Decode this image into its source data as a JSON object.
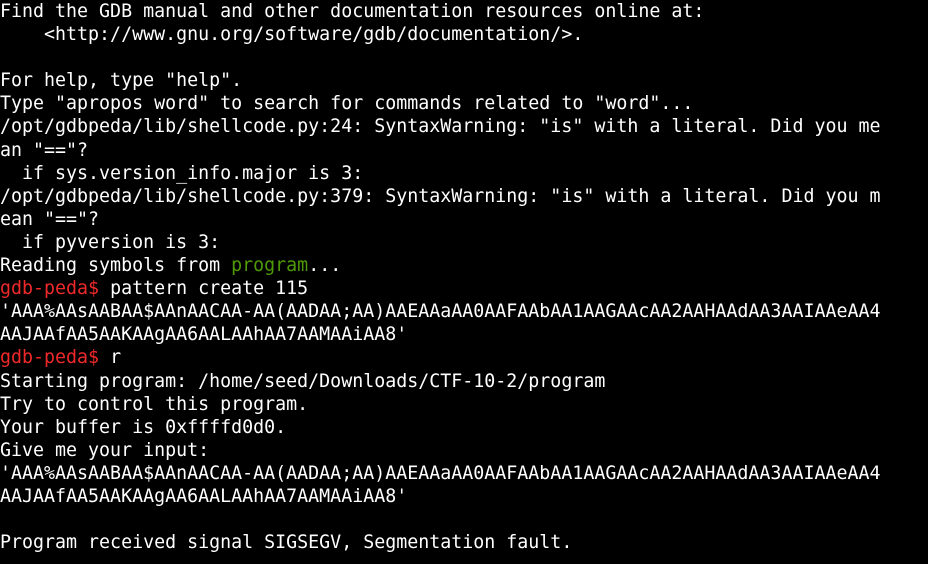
{
  "colors": {
    "background": "#000000",
    "text": "#ffffff",
    "prompt": "#ef2929",
    "highlight": "#4e9a06"
  },
  "terminal": {
    "l01": "Find the GDB manual and other documentation resources online at:",
    "l02": "    <http://www.gnu.org/software/gdb/documentation/>.",
    "l03": "",
    "l04": "For help, type \"help\".",
    "l05": "Type \"apropos word\" to search for commands related to \"word\"...",
    "l06": "/opt/gdbpeda/lib/shellcode.py:24: SyntaxWarning: \"is\" with a literal. Did you me",
    "l07": "an \"==\"?",
    "l08": "  if sys.version_info.major is 3:",
    "l09": "/opt/gdbpeda/lib/shellcode.py:379: SyntaxWarning: \"is\" with a literal. Did you m",
    "l10": "ean \"==\"?",
    "l11": "  if pyversion is 3:",
    "l12_prefix": "Reading symbols from ",
    "l12_name": "program",
    "l12_suffix": "...",
    "prompt1": "gdb-peda$",
    "command1": " pattern create 115",
    "l14": "'AAA%AAsAABAA$AAnAACAA-AA(AADAA;AA)AAEAAaAA0AAFAAbAA1AAGAAcAA2AAHAAdAA3AAIAAeAA4",
    "l15": "AAJAAfAA5AAKAAgAA6AALAAhAA7AAMAAiAA8'",
    "prompt2": "gdb-peda$",
    "command2": " r",
    "l17": "Starting program: /home/seed/Downloads/CTF-10-2/program",
    "l18": "Try to control this program.",
    "l19": "Your buffer is 0xffffd0d0.",
    "l20": "Give me your input:",
    "l21": "'AAA%AAsAABAA$AAnAACAA-AA(AADAA;AA)AAEAAaAA0AAFAAbAA1AAGAAcAA2AAHAAdAA3AAIAAeAA4",
    "l22": "AAJAAfAA5AAKAAgAA6AALAAhAA7AAMAAiAA8'",
    "l23": "",
    "l24": "Program received signal SIGSEGV, Segmentation fault."
  }
}
